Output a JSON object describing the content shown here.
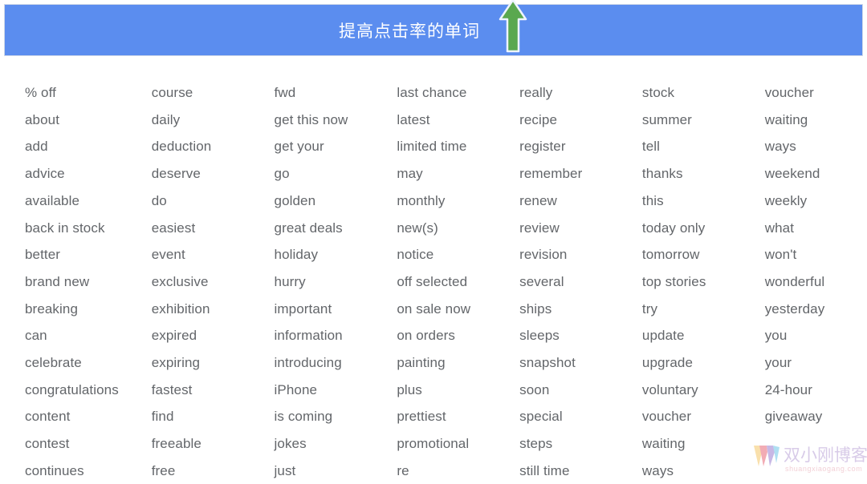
{
  "banner": {
    "title": "提高点击率的单词",
    "background_color": "#5b8def",
    "title_color": "#ffffff",
    "arrow_icon": "arrow-up-icon",
    "arrow_color": "#5aa84f"
  },
  "word_list": {
    "text_color": "#63666a",
    "columns": [
      {
        "index": 1,
        "words": [
          "% off",
          "about",
          "add",
          "advice",
          "available",
          "back in stock",
          "better",
          "brand new",
          "breaking",
          "can",
          "celebrate",
          "congratulations",
          "content",
          "contest",
          "continues"
        ]
      },
      {
        "index": 2,
        "words": [
          "course",
          "daily",
          "deduction",
          "deserve",
          "do",
          "easiest",
          "event",
          "exclusive",
          "exhibition",
          "expired",
          "expiring",
          "fastest",
          "find",
          "freeable",
          "free"
        ]
      },
      {
        "index": 3,
        "words": [
          "fwd",
          "get this now",
          "get your",
          "go",
          "golden",
          "great deals",
          "holiday",
          "hurry",
          "important",
          "information",
          "introducing",
          "iPhone",
          "is coming",
          "jokes",
          "just"
        ]
      },
      {
        "index": 4,
        "words": [
          "last chance",
          "latest",
          "limited time",
          "may",
          "monthly",
          "new(s)",
          "notice",
          "off selected",
          "on sale now",
          "on orders",
          "painting",
          "plus",
          "prettiest",
          "promotional",
          "re"
        ]
      },
      {
        "index": 5,
        "words": [
          "really",
          "recipe",
          "register",
          "remember",
          "renew",
          "review",
          "revision",
          "several",
          "ships",
          "sleeps",
          "snapshot",
          "soon",
          "special",
          "steps",
          "still time"
        ]
      },
      {
        "index": 6,
        "words": [
          "stock",
          "summer",
          "tell",
          "thanks",
          "this",
          "today only",
          "tomorrow",
          "top stories",
          "try",
          "update",
          "upgrade",
          "voluntary",
          "voucher",
          "waiting",
          "ways"
        ]
      },
      {
        "index": 7,
        "words": [
          "voucher",
          "waiting",
          "ways",
          "weekend",
          "weekly",
          "what",
          "won't",
          "wonderful",
          "yesterday",
          "you",
          "your",
          "24-hour",
          "giveaway"
        ]
      }
    ]
  },
  "watermark": {
    "title": "双小刚博客",
    "url": "shuangxiaogang.com",
    "logo_icon": "w-logo-icon",
    "title_color": "#b9a2d6",
    "url_color": "#e8a9b4"
  }
}
